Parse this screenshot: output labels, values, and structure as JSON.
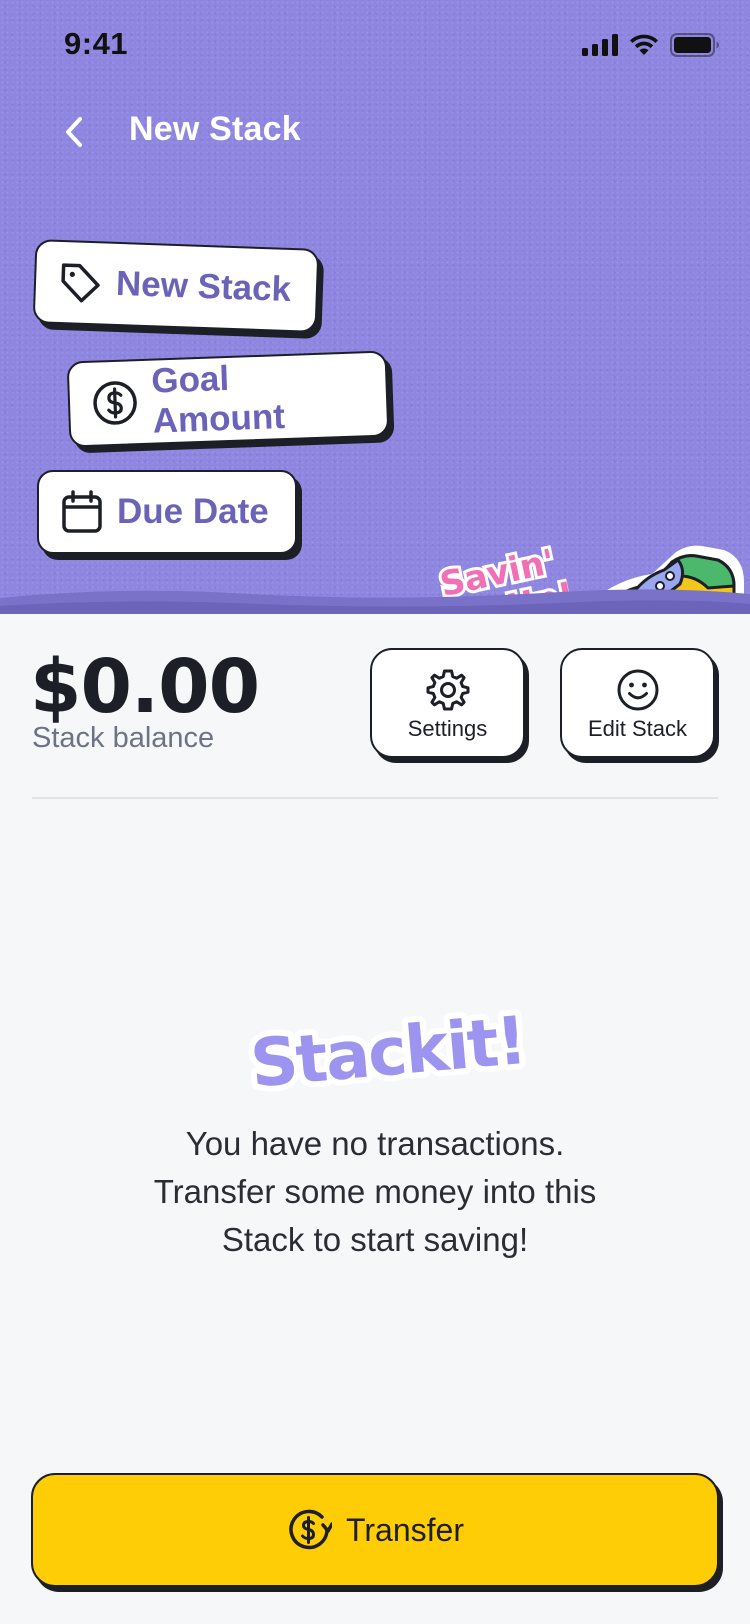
{
  "status_bar": {
    "time": "9:41"
  },
  "nav": {
    "title": "New Stack",
    "back_icon": "chevron-left-icon"
  },
  "stickers": {
    "name_label": "New Stack",
    "goal_label": "Goal Amount",
    "due_label": "Due Date",
    "savin_line1": "Savin'",
    "savin_line2": "On Up!"
  },
  "balance": {
    "amount": "$0.00",
    "label": "Stack balance"
  },
  "actions": {
    "settings_label": "Settings",
    "edit_label": "Edit Stack"
  },
  "empty_state": {
    "logo_text": "Stackit!",
    "message": "You have no transactions.\nTransfer some money into this\nStack to start saving!"
  },
  "transfer": {
    "label": "Transfer"
  },
  "colors": {
    "hero_bg": "#8e86e0",
    "sticker_text": "#6a63b8",
    "primary_button": "#ffcd05",
    "page_bg": "#f6f7f9",
    "ink": "#1d1f27",
    "logo_fill": "#9c94ee",
    "pink_sticker": "#f06fb5"
  }
}
